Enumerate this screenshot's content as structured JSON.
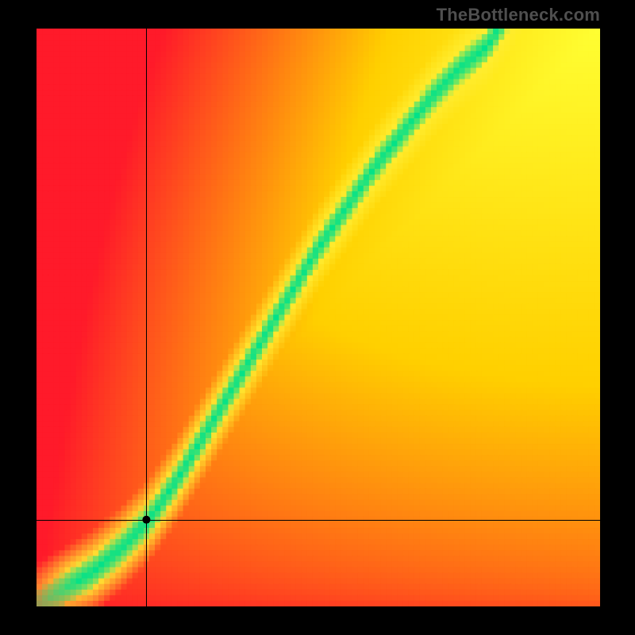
{
  "watermark": "TheBottleneck.com",
  "colors": {
    "black": "#000000",
    "crosshair": "#000000"
  },
  "chart_data": {
    "type": "heatmap",
    "title": "",
    "xlabel": "",
    "ylabel": "",
    "xlim": [
      0,
      1
    ],
    "ylim": [
      0,
      1
    ],
    "grid": false,
    "legend": false,
    "background_gradient": {
      "note": "Radial-like smooth field, red at upper-left and lower-right, yellow toward the diagonal/upper-right, per-pixel blend",
      "stops": [
        {
          "t": 0.0,
          "color": "#ff1a2a"
        },
        {
          "t": 0.5,
          "color": "#ffd000"
        },
        {
          "t": 1.0,
          "color": "#ffff33"
        }
      ]
    },
    "ridge": {
      "note": "Green optimal-balance ridge; y ≈ f(x), soft yellow halo around it",
      "color_core": "#00e28a",
      "color_halo": "#ffee33",
      "points": [
        {
          "x": 0.0,
          "y": 0.0
        },
        {
          "x": 0.05,
          "y": 0.03
        },
        {
          "x": 0.1,
          "y": 0.06
        },
        {
          "x": 0.15,
          "y": 0.1
        },
        {
          "x": 0.2,
          "y": 0.15
        },
        {
          "x": 0.25,
          "y": 0.22
        },
        {
          "x": 0.3,
          "y": 0.3
        },
        {
          "x": 0.35,
          "y": 0.38
        },
        {
          "x": 0.4,
          "y": 0.46
        },
        {
          "x": 0.45,
          "y": 0.54
        },
        {
          "x": 0.5,
          "y": 0.62
        },
        {
          "x": 0.55,
          "y": 0.69
        },
        {
          "x": 0.6,
          "y": 0.76
        },
        {
          "x": 0.65,
          "y": 0.82
        },
        {
          "x": 0.7,
          "y": 0.88
        },
        {
          "x": 0.75,
          "y": 0.93
        },
        {
          "x": 0.8,
          "y": 0.97
        },
        {
          "x": 0.82,
          "y": 1.0
        }
      ],
      "core_half_width": 0.028,
      "halo_half_width": 0.075
    },
    "crosshair": {
      "note": "Black crosshair lines with marker dot",
      "x": 0.195,
      "y": 0.15,
      "dot_radius_px": 5
    },
    "pixelation": {
      "cells_x": 100,
      "cells_y": 103
    }
  }
}
